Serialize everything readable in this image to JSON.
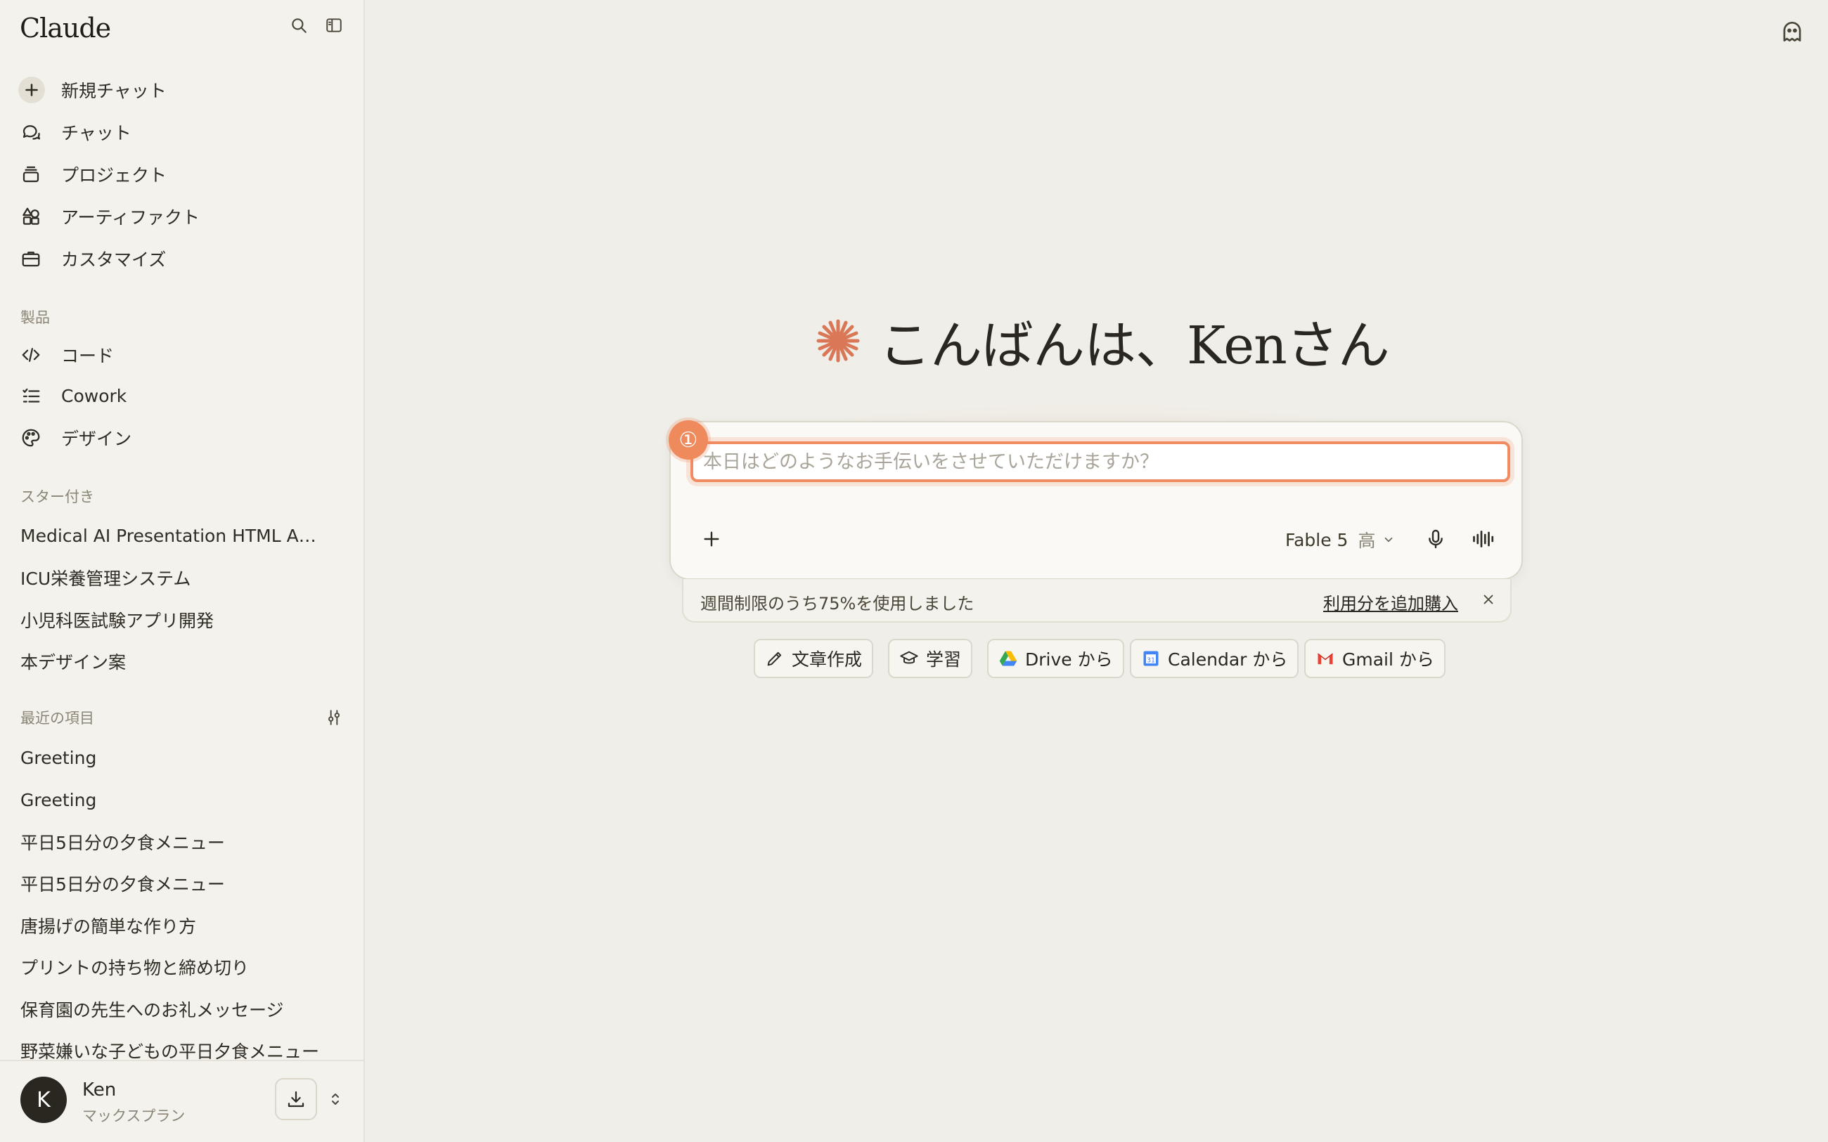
{
  "app": {
    "logo": "Claude"
  },
  "sidebar": {
    "nav": [
      {
        "label": "新規チャット",
        "icon": "plus-icon"
      },
      {
        "label": "チャット",
        "icon": "chat-bubbles-icon"
      },
      {
        "label": "プロジェクト",
        "icon": "folder-stack-icon"
      },
      {
        "label": "アーティファクト",
        "icon": "shapes-icon"
      },
      {
        "label": "カスタマイズ",
        "icon": "briefcase-icon"
      }
    ],
    "products_label": "製品",
    "products": [
      {
        "label": "コード",
        "icon": "code-icon"
      },
      {
        "label": "Cowork",
        "icon": "checklist-icon"
      },
      {
        "label": "デザイン",
        "icon": "palette-icon"
      }
    ],
    "starred_label": "スター付き",
    "starred": [
      "Medical AI Presentation HTML Analysis",
      "ICU栄養管理システム",
      "小児科医試験アプリ開発",
      "本デザイン案"
    ],
    "recent_label": "最近の項目",
    "recent": [
      "Greeting",
      "Greeting",
      "平日5日分の夕食メニュー",
      "平日5日分の夕食メニュー",
      "唐揚げの簡単な作り方",
      "プリントの持ち物と締め切り",
      "保育園の先生へのお礼メッセージ",
      "野菜嫌いな子どもの平日夕食メニュー"
    ],
    "user": {
      "initial": "K",
      "name": "Ken",
      "plan": "マックスプラン"
    }
  },
  "main": {
    "greeting": "こんばんは、Kenさん",
    "input_placeholder": "本日はどのようなお手伝いをさせていただけますか？",
    "input_value": "",
    "badge": "①",
    "model": "Fable 5",
    "effort": "高",
    "usage_text": "週間制限のうち75%を使用しました",
    "usage_link": "利用分を追加購入",
    "chips": [
      {
        "label": "文章作成",
        "icon": "pencil-icon"
      },
      {
        "label": "学習",
        "icon": "graduation-cap-icon"
      },
      {
        "label": "Drive から",
        "icon": "google-drive-icon"
      },
      {
        "label": "Calendar から",
        "icon": "google-calendar-icon"
      },
      {
        "label": "Gmail から",
        "icon": "gmail-icon"
      }
    ]
  },
  "colors": {
    "accent": "#d97757",
    "highlight": "#f08b62",
    "background": "#f0eee8",
    "sidebar": "#f4f2ec"
  }
}
